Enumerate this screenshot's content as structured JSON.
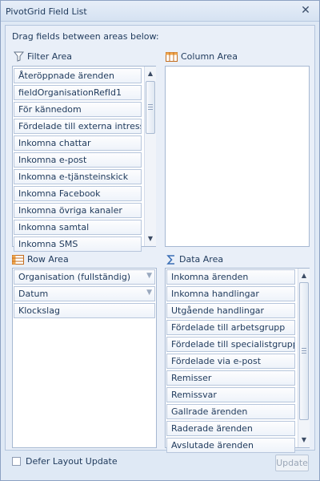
{
  "window": {
    "title": "PivotGrid Field List"
  },
  "hint": "Drag fields between areas below:",
  "filter_area": {
    "label": "Filter Area",
    "items": [
      "Återöppnade ärenden",
      "fieldOrganisationRefId1",
      "För kännedom",
      "Fördelade till externa intress…",
      "Inkomna chattar",
      "Inkomna e-post",
      "Inkomna e-tjänsteinskick",
      "Inkomna Facebook",
      "Inkomna övriga kanaler",
      "Inkomna samtal",
      "Inkomna SMS"
    ]
  },
  "column_area": {
    "label": "Column Area",
    "items": []
  },
  "row_area": {
    "label": "Row Area",
    "items": [
      {
        "label": "Organisation (fullständig)",
        "filter_icon": true
      },
      {
        "label": "Datum",
        "filter_icon": true
      },
      {
        "label": "Klockslag",
        "filter_icon": false
      }
    ]
  },
  "data_area": {
    "label": "Data Area",
    "items": [
      "Inkomna ärenden",
      "Inkomna handlingar",
      "Utgående handlingar",
      "Fördelade till arbetsgrupp",
      "Fördelade till specialistgrupp",
      "Fördelade via e-post",
      "Remisser",
      "Remissvar",
      "Gallrade ärenden",
      "Raderade ärenden",
      "Avslutade ärenden"
    ]
  },
  "footer": {
    "defer_label": "Defer Layout Update",
    "update_label": "Update"
  }
}
